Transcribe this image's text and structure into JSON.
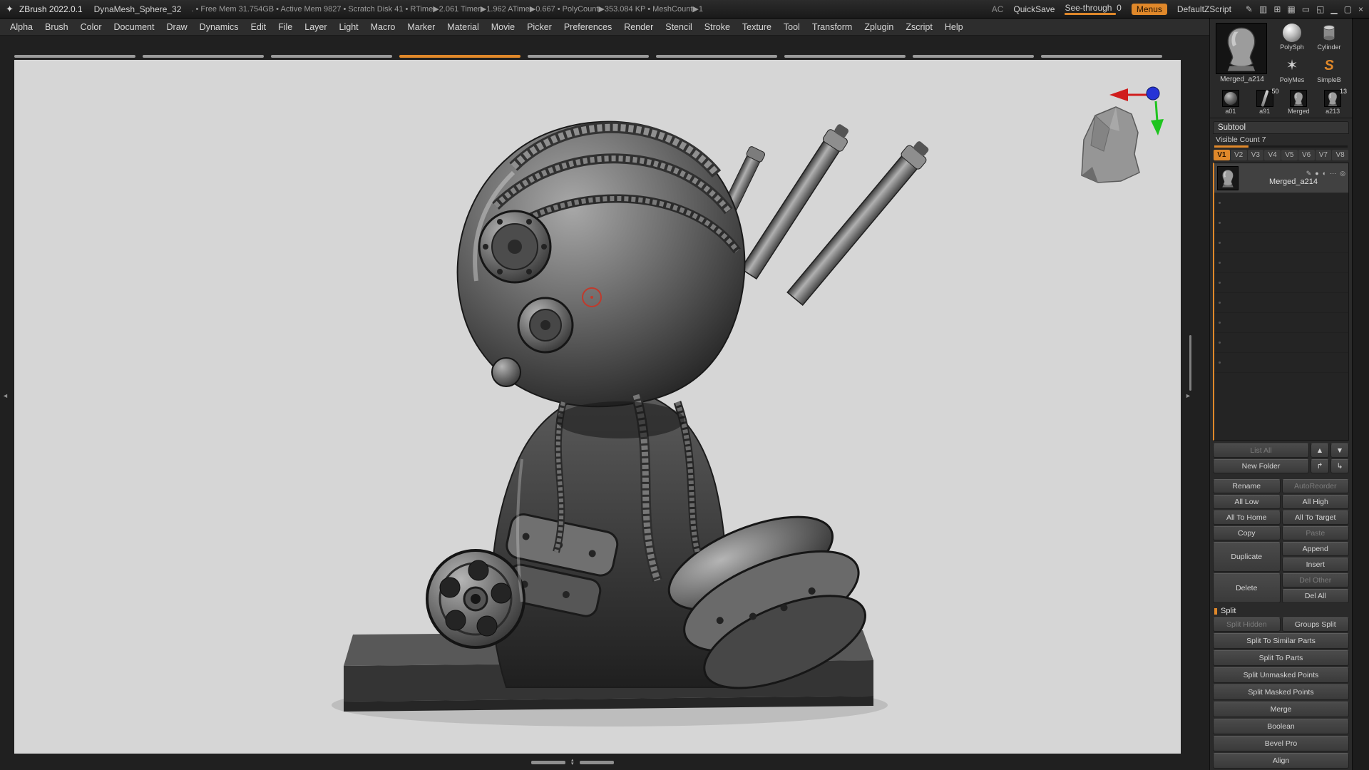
{
  "colors": {
    "accent": "#e0882a",
    "cursor": "#c03a2c",
    "axis_x": "#d01d1d",
    "axis_y": "#1ec41e",
    "axis_z": "#2633d6",
    "canvas_bg": "#d6d6d6"
  },
  "titlebar": {
    "logo_glyph": "✦",
    "app_title": "ZBrush 2022.0.1",
    "doc_title": "DynaMesh_Sphere_32",
    "stats": ". • Free Mem 31.754GB • Active Mem 9827 • Scratch Disk 41 •  RTime▶2.061 Timer▶1.962 ATime▶0.667 • PolyCount▶353.084 KP • MeshCount▶1",
    "ac": "AC",
    "quicksave": "QuickSave",
    "seethrough_label": "See-through",
    "seethrough_value": "0",
    "menus": "Menus",
    "zscript": "DefaultZScript",
    "icons": {
      "stylus": "✎",
      "tablet": "▥",
      "panels": "⊞",
      "grid": "▦",
      "screen": "▭",
      "corner": "◱",
      "minimize": "▁",
      "restore": "▢",
      "close": "×"
    }
  },
  "menubar": {
    "items": [
      "Alpha",
      "Brush",
      "Color",
      "Document",
      "Draw",
      "Dynamics",
      "Edit",
      "File",
      "Layer",
      "Light",
      "Macro",
      "Marker",
      "Material",
      "Movie",
      "Picker",
      "Preferences",
      "Render",
      "Stencil",
      "Stroke",
      "Texture",
      "Tool",
      "Transform",
      "Zplugin",
      "Zscript",
      "Help"
    ]
  },
  "gutters": {
    "left_arrow": "◄",
    "right_arrow": "►",
    "scroll_up": "▴",
    "scroll_down": "▾"
  },
  "tool_palette": {
    "active_label": "Merged_a214",
    "quick": [
      {
        "label": "PolySph"
      },
      {
        "label": "Cylinder"
      },
      {
        "label": "PolyMes",
        "glyph": "✶"
      },
      {
        "label": "SimpleB",
        "glyph": "S"
      }
    ],
    "recent": [
      {
        "label": "a01",
        "badge": ""
      },
      {
        "label": "a91",
        "badge": "50"
      },
      {
        "label": "Merged",
        "badge": ""
      },
      {
        "label": "a213",
        "badge": "13"
      }
    ]
  },
  "subtool": {
    "title": "Subtool",
    "visible_count_label": "Visible Count",
    "visible_count_value": "7",
    "tabs": [
      "V1",
      "V2",
      "V3",
      "V4",
      "V5",
      "V6",
      "V7",
      "V8"
    ],
    "item_label": "Merged_a214",
    "item_icons": [
      "✎",
      "●",
      "◐",
      "⋯",
      "◎"
    ],
    "buttons": {
      "list_all": "List All",
      "move_up": "▲",
      "move_down": "▼",
      "new_folder": "New Folder",
      "folder_up": "↱",
      "folder_down": "↳",
      "rename": "Rename",
      "autoreorder": "AutoReorder",
      "all_low": "All Low",
      "all_high": "All High",
      "all_to_home": "All To Home",
      "all_to_target": "All To Target",
      "copy": "Copy",
      "paste": "Paste",
      "duplicate": "Duplicate",
      "append": "Append",
      "insert": "Insert",
      "delete": "Delete",
      "del_other": "Del Other",
      "del_all": "Del All"
    },
    "split": {
      "title": "Split",
      "split_hidden": "Split Hidden",
      "groups_split": "Groups Split",
      "split_to_similar_parts": "Split To Similar Parts",
      "split_to_parts": "Split To Parts",
      "split_unmasked_points": "Split Unmasked Points",
      "split_masked_points": "Split Masked Points",
      "merge": "Merge",
      "boolean": "Boolean",
      "bevel_pro": "Bevel Pro",
      "align": "Align"
    }
  }
}
